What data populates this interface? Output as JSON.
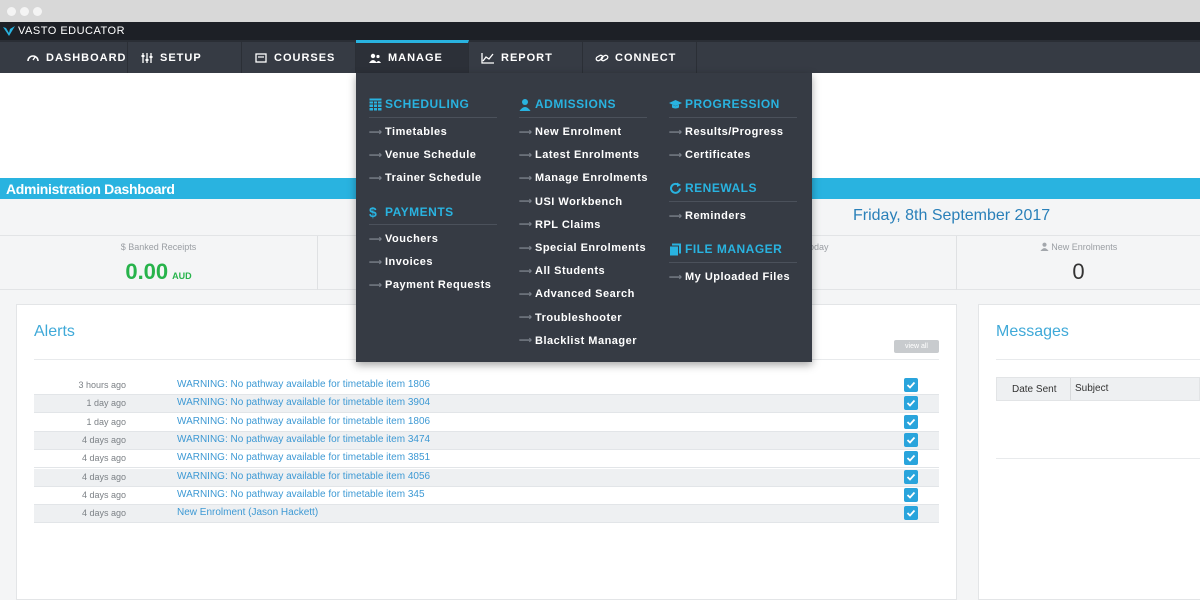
{
  "app": {
    "name": "VASTO EDUCATOR"
  },
  "nav": {
    "items": [
      {
        "label": "DASHBOARD",
        "icon": "dashboard-gauge-icon"
      },
      {
        "label": "SETUP",
        "icon": "sliders-icon"
      },
      {
        "label": "COURSES",
        "icon": "courses-book-icon"
      },
      {
        "label": "MANAGE",
        "icon": "users-icon",
        "active": true
      },
      {
        "label": "REPORT",
        "icon": "line-chart-icon"
      },
      {
        "label": "CONNECT",
        "icon": "link-icon"
      }
    ]
  },
  "dropdown": {
    "scheduling": {
      "title": "SCHEDULING",
      "items": [
        "Timetables",
        "Venue Schedule",
        "Trainer Schedule"
      ]
    },
    "payments": {
      "title": "PAYMENTS",
      "items": [
        "Vouchers",
        "Invoices",
        "Payment Requests"
      ]
    },
    "admissions": {
      "title": "ADMISSIONS",
      "items": [
        "New Enrolment",
        "Latest Enrolments",
        "Manage Enrolments",
        "USI Workbench",
        "RPL Claims",
        "Special Enrolments",
        "All Students",
        "Advanced Search",
        "Troubleshooter",
        "Blacklist Manager"
      ]
    },
    "progression": {
      "title": "PROGRESSION",
      "items": [
        "Results/Progress",
        "Certificates"
      ]
    },
    "renewals": {
      "title": "RENEWALS",
      "items": [
        "Reminders"
      ]
    },
    "file_manager": {
      "title": "FILE MANAGER",
      "items": [
        "My Uploaded Files"
      ]
    },
    "arrow": "⟶"
  },
  "dashboard": {
    "title": "Administration Dashboard",
    "date": "Friday, 8th September 2017",
    "stats": {
      "banked": {
        "label": "$ Banked Receipts",
        "value": "0.00",
        "unit": "AUD"
      },
      "hidden_label": "oday",
      "enrolments": {
        "label": "New Enrolments",
        "value": "0"
      }
    }
  },
  "alerts": {
    "title": "Alerts",
    "view_all": "view all",
    "rows": [
      {
        "time": "3 hours ago",
        "message": "WARNING: No pathway available for timetable item 1806"
      },
      {
        "time": "1 day ago",
        "message": "WARNING: No pathway available for timetable item 3904"
      },
      {
        "time": "1 day ago",
        "message": "WARNING: No pathway available for timetable item 1806"
      },
      {
        "time": "4 days ago",
        "message": "WARNING: No pathway available for timetable item 3474"
      },
      {
        "time": "4 days ago",
        "message": "WARNING: No pathway available for timetable item 3851"
      },
      {
        "time": "4 days ago",
        "message": "WARNING: No pathway available for timetable item 4056"
      },
      {
        "time": "4 days ago",
        "message": "WARNING: No pathway available for timetable item 345"
      },
      {
        "time": "4 days ago",
        "message": "New Enrolment (Jason Hackett)"
      }
    ]
  },
  "messages": {
    "title": "Messages",
    "columns": [
      "Date Sent",
      "Subject"
    ]
  },
  "colors": {
    "accent": "#29b3e0",
    "nav_bg": "#363b44",
    "green": "#27b34b",
    "link": "#3d99d4"
  }
}
